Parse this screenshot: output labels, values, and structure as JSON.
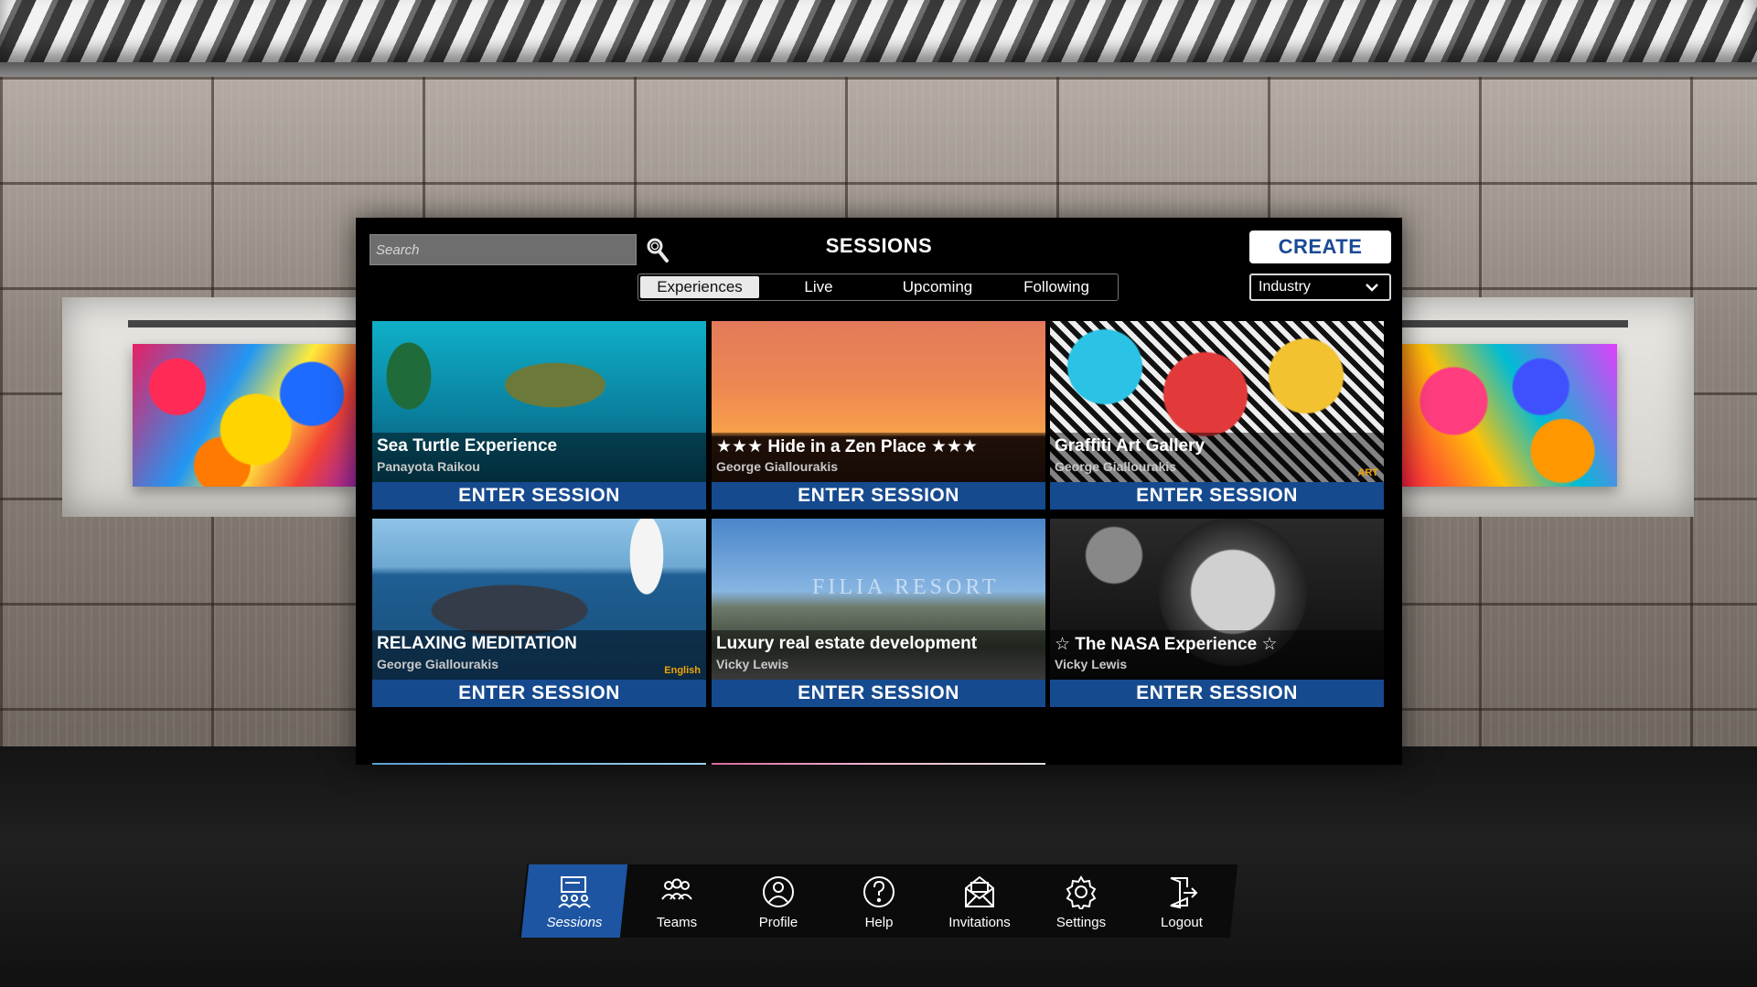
{
  "panel": {
    "title": "SESSIONS",
    "search_placeholder": "Search",
    "create_label": "CREATE",
    "tabs": [
      {
        "label": "Experiences",
        "active": true
      },
      {
        "label": "Live",
        "active": false
      },
      {
        "label": "Upcoming",
        "active": false
      },
      {
        "label": "Following",
        "active": false
      }
    ],
    "filter": {
      "selected": "Industry"
    },
    "enter_label": "ENTER SESSION",
    "cards": [
      {
        "title": "Sea Turtle Experience",
        "author": "Panayota Raikou",
        "tag": ""
      },
      {
        "title": "★★★ Hide in a Zen Place ★★★",
        "author": "George Giallourakis",
        "tag": ""
      },
      {
        "title": "Graffiti Art Gallery",
        "author": "George Giallourakis",
        "tag": "ART"
      },
      {
        "title": "RELAXING MEDITATION",
        "author": "George Giallourakis",
        "tag": "English"
      },
      {
        "title": "Luxury real estate development",
        "author": "Vicky Lewis",
        "tag": "",
        "thumb_text": "FILIA RESORT"
      },
      {
        "title": "☆ The NASA Experience ☆",
        "author": "Vicky Lewis",
        "tag": ""
      }
    ]
  },
  "nav": {
    "items": [
      {
        "label": "Sessions",
        "icon": "sessions-icon",
        "active": true
      },
      {
        "label": "Teams",
        "icon": "teams-icon",
        "active": false
      },
      {
        "label": "Profile",
        "icon": "profile-icon",
        "active": false
      },
      {
        "label": "Help",
        "icon": "help-icon",
        "active": false
      },
      {
        "label": "Invitations",
        "icon": "invitations-icon",
        "active": false
      },
      {
        "label": "Settings",
        "icon": "settings-icon",
        "active": false
      },
      {
        "label": "Logout",
        "icon": "logout-icon",
        "active": false
      }
    ]
  },
  "colors": {
    "accent_blue": "#164a8f",
    "nav_active": "#1e55a3",
    "tag_orange": "#f0a400"
  }
}
